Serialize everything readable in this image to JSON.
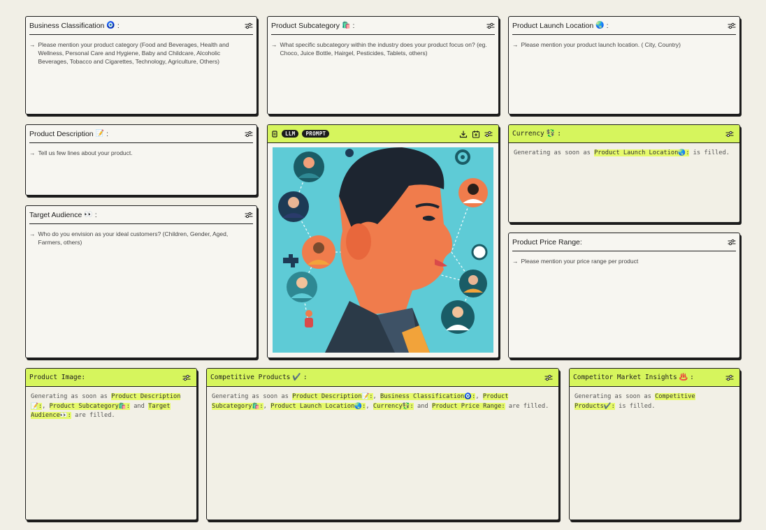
{
  "cards": {
    "business_classification": {
      "title": "Business Classification",
      "emoji": "🧿",
      "suffix": ":",
      "hint": "Please mention your product category (Food and Beverages, Health and Wellness, Personal Care and Hygiene, Baby and Childcare, Alcoholic Beverages, Tobacco and Cigarettes, Technology, Agriculture, Others)"
    },
    "product_subcategory": {
      "title": "Product Subcategory",
      "emoji": "🛍️",
      "suffix": ":",
      "hint": "What specific subcategory within the industry does your product focus on? (eg. Choco, Juice Bottle, Hairgel, Pesticides, Tablets, others)"
    },
    "product_launch_location": {
      "title": "Product Launch Location",
      "emoji": "🌏",
      "suffix": ":",
      "hint": "Please mention your product launch location. ( City, Country)"
    },
    "product_description": {
      "title": "Product Description",
      "emoji": "📝",
      "suffix": ":",
      "hint": "Tell us few lines about your product."
    },
    "target_audience": {
      "title": "Target Audience",
      "emoji": "👀",
      "suffix": ":",
      "hint": "Who do you envision as your ideal customers? (Children, Gender, Aged, Farmers, others)"
    },
    "product_price_range": {
      "title": "Product Price Range:",
      "hint": "Please mention your price range per product"
    },
    "llm": {
      "pill_llm": "LLM",
      "pill_prompt": "PROMPT"
    },
    "currency": {
      "title": "Currency",
      "emoji": "💱",
      "suffix": ":",
      "text_pre": "Generating as soon as ",
      "dep_1": "Product Launch Location🌏:",
      "text_post": " is filled."
    },
    "product_image": {
      "title": "Product Image:",
      "text_pre": "Generating as soon as ",
      "dep_1": "Product Description📝:",
      "sep_1": ", ",
      "dep_2": "Product Subcategory🛍️:",
      "sep_2": " and ",
      "dep_3": "Target Audience👀:",
      "text_post": " are filled."
    },
    "competitive_products": {
      "title": "Competitive Products",
      "emoji": "✔️",
      "suffix": ":",
      "text_pre": "Generating as soon as ",
      "dep_1": "Product Description📝:",
      "sep_1": ", ",
      "dep_2": "Business Classification🧿:",
      "sep_2": ", ",
      "dep_3": "Product Subcategory🛍️:",
      "sep_3": ", ",
      "dep_4": "Product Launch Location🌏:",
      "sep_4": ", ",
      "dep_5": "Currency💱:",
      "sep_5": " and ",
      "dep_6": "Product Price Range:",
      "text_post": " are filled."
    },
    "competitor_market_insights": {
      "title": "Competitor Market Insights",
      "emoji": "♨️",
      "suffix": ":",
      "text_pre": "Generating as soon as ",
      "dep_1": "Competitive Products✔️:",
      "text_post": " is filled."
    }
  },
  "icons": {
    "settings": "sliders-icon",
    "download": "download-icon",
    "calendar": "calendar-icon",
    "node": "node-icon"
  },
  "colors": {
    "accent": "#d6f55d",
    "highlight": "#e6fa6b",
    "background": "#f1efe6",
    "art_background": "#5ecbd6"
  }
}
